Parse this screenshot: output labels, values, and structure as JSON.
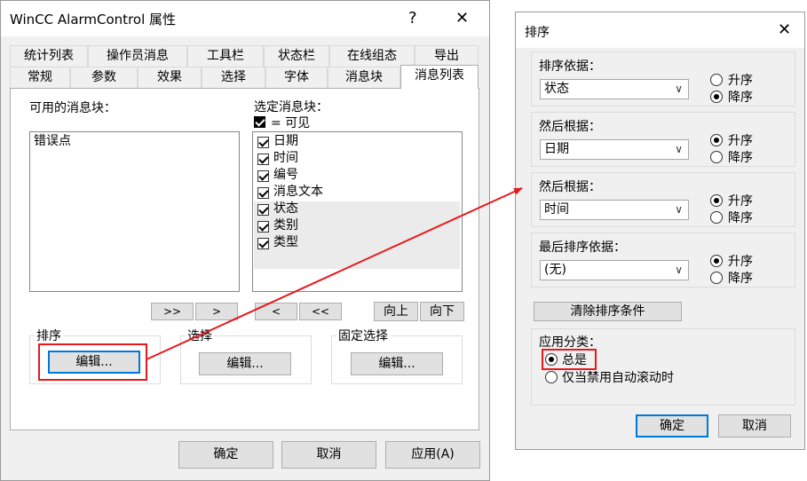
{
  "left_dialog": {
    "title": "WinCC AlarmControl 属性",
    "help_glyph": "?",
    "close_glyph": "✕",
    "tabs_row1": [
      "统计列表",
      "操作员消息",
      "工具栏",
      "状态栏",
      "在线组态",
      "导出"
    ],
    "tabs_row2": [
      "常规",
      "参数",
      "效果",
      "选择",
      "字体",
      "消息块",
      "消息列表"
    ],
    "active_tab": "消息列表",
    "available_blocks_label": "可用的消息块：",
    "available_blocks": [
      "错误点"
    ],
    "selected_blocks_label": "选定消息块：",
    "visible_legend": "= 可见",
    "selected_blocks": [
      "日期",
      "时间",
      "编号",
      "消息文本",
      "状态",
      "类别",
      "类型"
    ],
    "move_buttons": [
      ">>",
      ">",
      "<",
      "<<"
    ],
    "order_buttons": [
      "向上",
      "向下"
    ],
    "sort_group_label": "排序",
    "sort_edit": "编辑...",
    "select_group_label": "选择",
    "select_edit": "编辑...",
    "fixed_group_label": "固定选择",
    "fixed_edit": "编辑...",
    "ok": "确定",
    "cancel": "取消",
    "apply": "应用(A)"
  },
  "right_dialog": {
    "title": "排序",
    "close_glyph": "✕",
    "sections": [
      {
        "label": "排序依据：",
        "value": "状态",
        "options": [
          "升序",
          "降序"
        ],
        "selected": 1
      },
      {
        "label": "然后根据：",
        "value": "日期",
        "options": [
          "升序",
          "降序"
        ],
        "selected": 0
      },
      {
        "label": "然后根据：",
        "value": "时间",
        "options": [
          "升序",
          "降序"
        ],
        "selected": 0
      },
      {
        "label": "最后排序依据：",
        "value": "(无)",
        "options": [
          "升序",
          "降序"
        ],
        "selected": 0
      }
    ],
    "clear_button": "清除排序条件",
    "apply_category_label": "应用分类：",
    "apply_options": [
      "总是",
      "仅当禁用自动滚动时"
    ],
    "apply_selected": 0,
    "ok": "确定",
    "cancel": "取消"
  },
  "colors": {
    "highlight": "#e8191e",
    "focus": "#0078d7"
  }
}
